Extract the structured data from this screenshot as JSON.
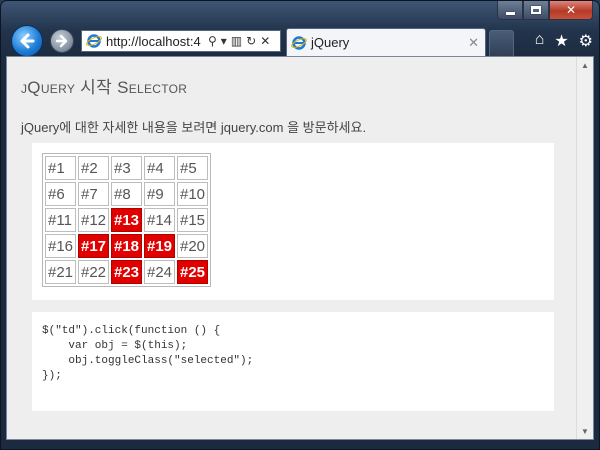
{
  "browser": {
    "url": "http://localhost:4",
    "tab_title": "jQuery",
    "icons": [
      "back-icon",
      "forward-icon",
      "ie-icon",
      "search-icon",
      "dropdown-icon",
      "compat-icon",
      "refresh-icon",
      "stop-icon",
      "close-icon",
      "home-icon",
      "favorites-star-icon",
      "tools-gear-icon"
    ]
  },
  "page": {
    "title": "jQuery 시작 Selector",
    "description": "jQuery에 대한 자세한 내용을 보려면 jquery.com 을 방문하세요."
  },
  "grid": {
    "rows": [
      [
        "#1",
        "#2",
        "#3",
        "#4",
        "#5"
      ],
      [
        "#6",
        "#7",
        "#8",
        "#9",
        "#10"
      ],
      [
        "#11",
        "#12",
        "#13",
        "#14",
        "#15"
      ],
      [
        "#16",
        "#17",
        "#18",
        "#19",
        "#20"
      ],
      [
        "#21",
        "#22",
        "#23",
        "#24",
        "#25"
      ]
    ],
    "selected": [
      "#13",
      "#17",
      "#18",
      "#19",
      "#23",
      "#25"
    ],
    "selected_color": "#e00000"
  },
  "code": {
    "lines": [
      "$(\"td\").click(function () {",
      "    var obj = $(this);",
      "    obj.toggleClass(\"selected\");",
      "});"
    ]
  }
}
